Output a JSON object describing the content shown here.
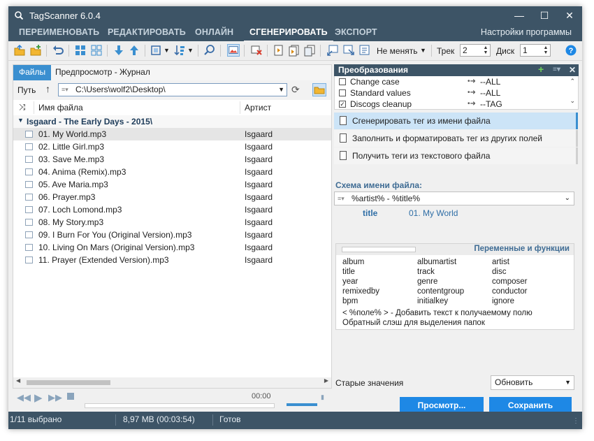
{
  "window": {
    "title": "TagScanner 6.0.4"
  },
  "menu": {
    "items": [
      "ПЕРЕИМЕНОВАТЬ",
      "РЕДАКТИРОВАТЬ",
      "ОНЛАЙН",
      "СГЕНЕРИРОВАТЬ",
      "ЭКСПОРТ"
    ],
    "active": "СГЕНЕРИРОВАТЬ",
    "settings": "Настройки программы"
  },
  "toolbar": {
    "case_mode": "Не менять",
    "track_label": "Трек",
    "track_value": "2",
    "disc_label": "Диск",
    "disc_value": "1"
  },
  "left": {
    "tabs": [
      "Файлы",
      "Предпросмотр - Журнал"
    ],
    "path_label": "Путь",
    "path_value": "C:\\Users\\wolf2\\Desktop\\",
    "col_filename": "Имя файла",
    "col_artist": "Артист",
    "group": "Isgaard - The Early Days - 2015\\",
    "files": [
      {
        "name": "01. My World.mp3",
        "artist": "Isgaard"
      },
      {
        "name": "02. Little Girl.mp3",
        "artist": "Isgaard"
      },
      {
        "name": "03. Save Me.mp3",
        "artist": "Isgaard"
      },
      {
        "name": "04. Anima (Remix).mp3",
        "artist": "Isgaard"
      },
      {
        "name": "05. Ave Maria.mp3",
        "artist": "Isgaard"
      },
      {
        "name": "06. Prayer.mp3",
        "artist": "Isgaard"
      },
      {
        "name": "07. Loch Lomond.mp3",
        "artist": "Isgaard"
      },
      {
        "name": "08. My Story.mp3",
        "artist": "Isgaard"
      },
      {
        "name": "09. I Burn For You (Original Version).mp3",
        "artist": "Isgaard"
      },
      {
        "name": "10. Living On Mars (Original Version).mp3",
        "artist": "Isgaard"
      },
      {
        "name": "11. Prayer (Extended Version).mp3",
        "artist": "Isgaard"
      }
    ],
    "player_time": "00:00"
  },
  "right": {
    "transforms_title": "Преобразования",
    "transforms": [
      {
        "label": "Change case",
        "checked": false,
        "target": "--ALL"
      },
      {
        "label": "Standard values",
        "checked": false,
        "target": "--ALL"
      },
      {
        "label": "Discogs cleanup",
        "checked": true,
        "target": "--TAG"
      }
    ],
    "actions": [
      "Сгенерировать тег из имени файла",
      "Заполнить и форматировать тег из других полей",
      "Получить теги из текстового файла"
    ],
    "scheme_label": "Схема имени файла:",
    "scheme_value": "%artist% - %title%",
    "preview_field": "title",
    "preview_value": "01. My World",
    "vars_title": "Переменные и функции",
    "vars": [
      "album",
      "albumartist",
      "artist",
      "title",
      "track",
      "disc",
      "year",
      "genre",
      "composer",
      "remixedby",
      "contentgroup",
      "conductor",
      "bpm",
      "initialkey",
      "ignore"
    ],
    "hint1": "< %поле% > - Добавить текст к получаемому полю",
    "hint2": "Обратный слэш для выделения папок",
    "old_values_label": "Старые значения",
    "old_values_select": "Обновить",
    "preview_button": "Просмотр...",
    "save_button": "Сохранить"
  },
  "status": {
    "selected": "1/11 выбрано",
    "size": "8,97 MB (00:03:54)",
    "state": "Готов"
  }
}
